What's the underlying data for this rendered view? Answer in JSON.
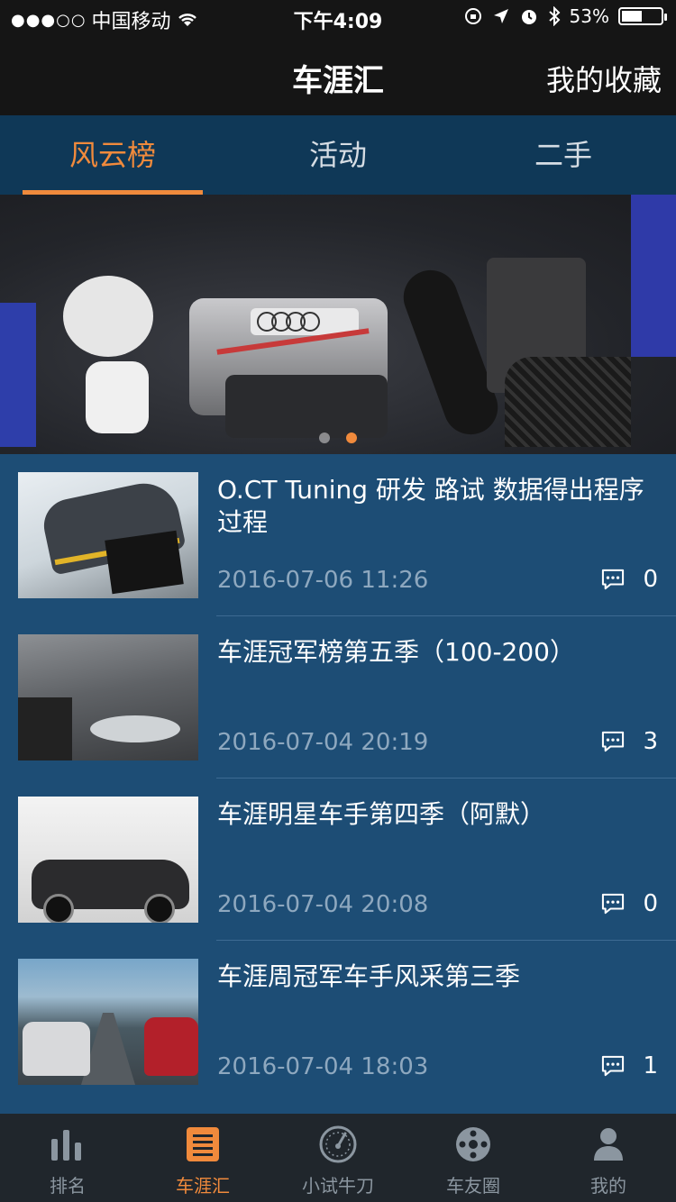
{
  "status_bar": {
    "signal_dots": "●●●○○",
    "carrier": "中国移动",
    "time": "下午4:09",
    "battery": "53%",
    "battery_level": 0.53
  },
  "nav": {
    "title": "车涯汇",
    "right_action": "我的收藏"
  },
  "tabs": [
    {
      "label": "风云榜",
      "active": true
    },
    {
      "label": "活动",
      "active": false
    },
    {
      "label": "二手",
      "active": false
    }
  ],
  "banner": {
    "page_count": 2,
    "active_page": 2
  },
  "articles": [
    {
      "title": "O.CT Tuning 研发 路试 数据得出程序过程",
      "date": "2016-07-06 11:26",
      "comments": "0"
    },
    {
      "title": "车涯冠军榜第五季（100-200）",
      "date": "2016-07-04 20:19",
      "comments": "3"
    },
    {
      "title": "车涯明星车手第四季（阿默）",
      "date": "2016-07-04 20:08",
      "comments": "0"
    },
    {
      "title": "车涯周冠军车手风采第三季",
      "date": "2016-07-04 18:03",
      "comments": "1"
    }
  ],
  "tabbar": [
    {
      "label": "排名",
      "icon": "bar-chart-icon",
      "active": false
    },
    {
      "label": "车涯汇",
      "icon": "document-icon",
      "active": true
    },
    {
      "label": "小试牛刀",
      "icon": "speedometer-icon",
      "active": false
    },
    {
      "label": "车友圈",
      "icon": "wheel-icon",
      "active": false
    },
    {
      "label": "我的",
      "icon": "person-icon",
      "active": false
    }
  ],
  "colors": {
    "accent": "#f08a3c",
    "list_bg": "#1d4d75",
    "tabs_bg": "#0f3857",
    "header_bg": "#151515",
    "tabbar_bg": "#20262c"
  }
}
